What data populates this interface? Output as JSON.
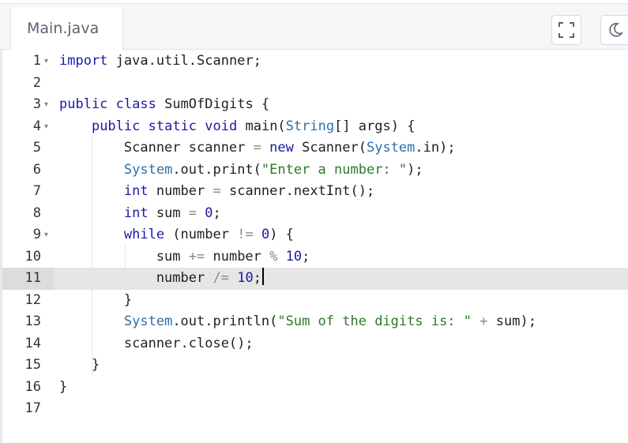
{
  "tabs": [
    {
      "label": "Main.java"
    }
  ],
  "toolbar": {
    "fullscreen_icon": "fullscreen-icon",
    "theme_icon": "moon-icon"
  },
  "editor": {
    "line_numbers": [
      "1",
      "2",
      "3",
      "4",
      "5",
      "6",
      "7",
      "8",
      "9",
      "10",
      "11",
      "12",
      "13",
      "14",
      "15",
      "16",
      "17"
    ],
    "active_line": "11",
    "lines": [
      "import java.util.Scanner;",
      "",
      "public class SumOfDigits {",
      "    public static void main(String[] args) {",
      "        Scanner scanner = new Scanner(System.in);",
      "        System.out.print(\"Enter a number: \");",
      "        int number = scanner.nextInt();",
      "        int sum = 0;",
      "        while (number != 0) {",
      "            sum += number % 10;",
      "            number /= 10;",
      "        }",
      "        System.out.println(\"Sum of the digits is: \" + sum);",
      "        scanner.close();",
      "    }",
      "}",
      ""
    ]
  }
}
